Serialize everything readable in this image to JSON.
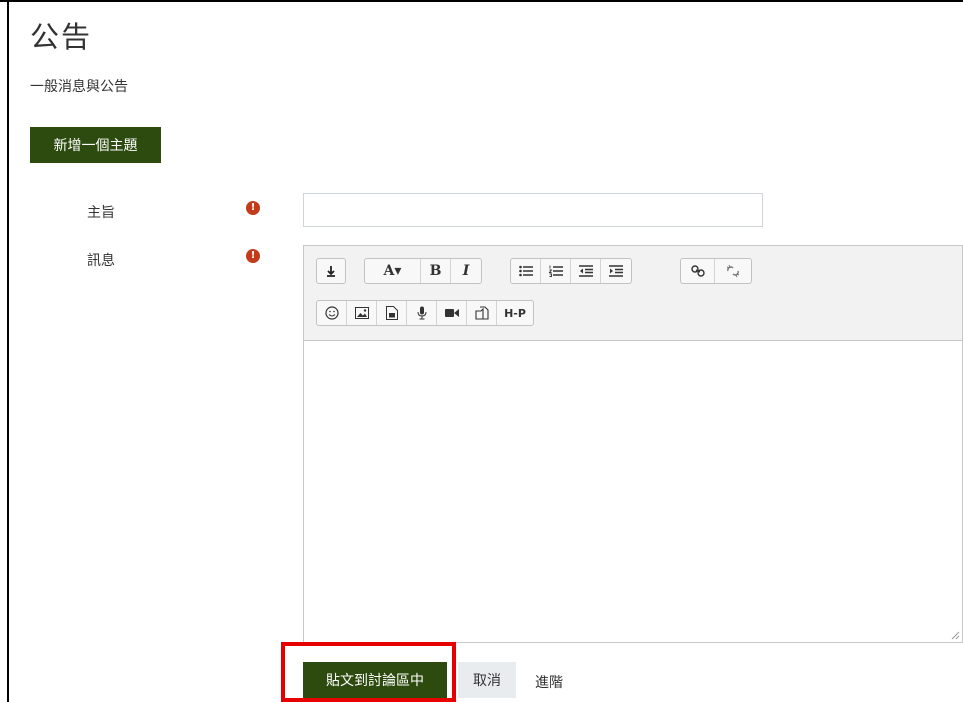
{
  "page": {
    "title": "公告",
    "subtitle": "一般消息與公告"
  },
  "actions": {
    "new_topic_label": "新增一個主題"
  },
  "form": {
    "subject": {
      "label": "主旨",
      "value": "",
      "required_icon": "exclamation-circle"
    },
    "message": {
      "label": "訊息",
      "required_icon": "exclamation-circle"
    },
    "toolbar": {
      "row1": [
        [
          "collapse"
        ],
        [
          "font-style",
          "bold",
          "italic"
        ],
        [
          "unordered-list",
          "ordered-list",
          "outdent",
          "indent"
        ],
        [
          "link",
          "unlink"
        ]
      ],
      "row2": [
        "emoji",
        "image",
        "media",
        "record-audio",
        "record-video",
        "manage-files",
        "h5p"
      ],
      "labels": {
        "font": "A▾",
        "bold": "B",
        "italic": "I",
        "h5p": "H-P"
      }
    }
  },
  "buttons": {
    "post": "貼文到討論區中",
    "cancel": "取消",
    "advanced": "進階"
  },
  "colors": {
    "primary": "#2d4a0f",
    "required": "#c23b1a",
    "highlight": "#e60000"
  }
}
